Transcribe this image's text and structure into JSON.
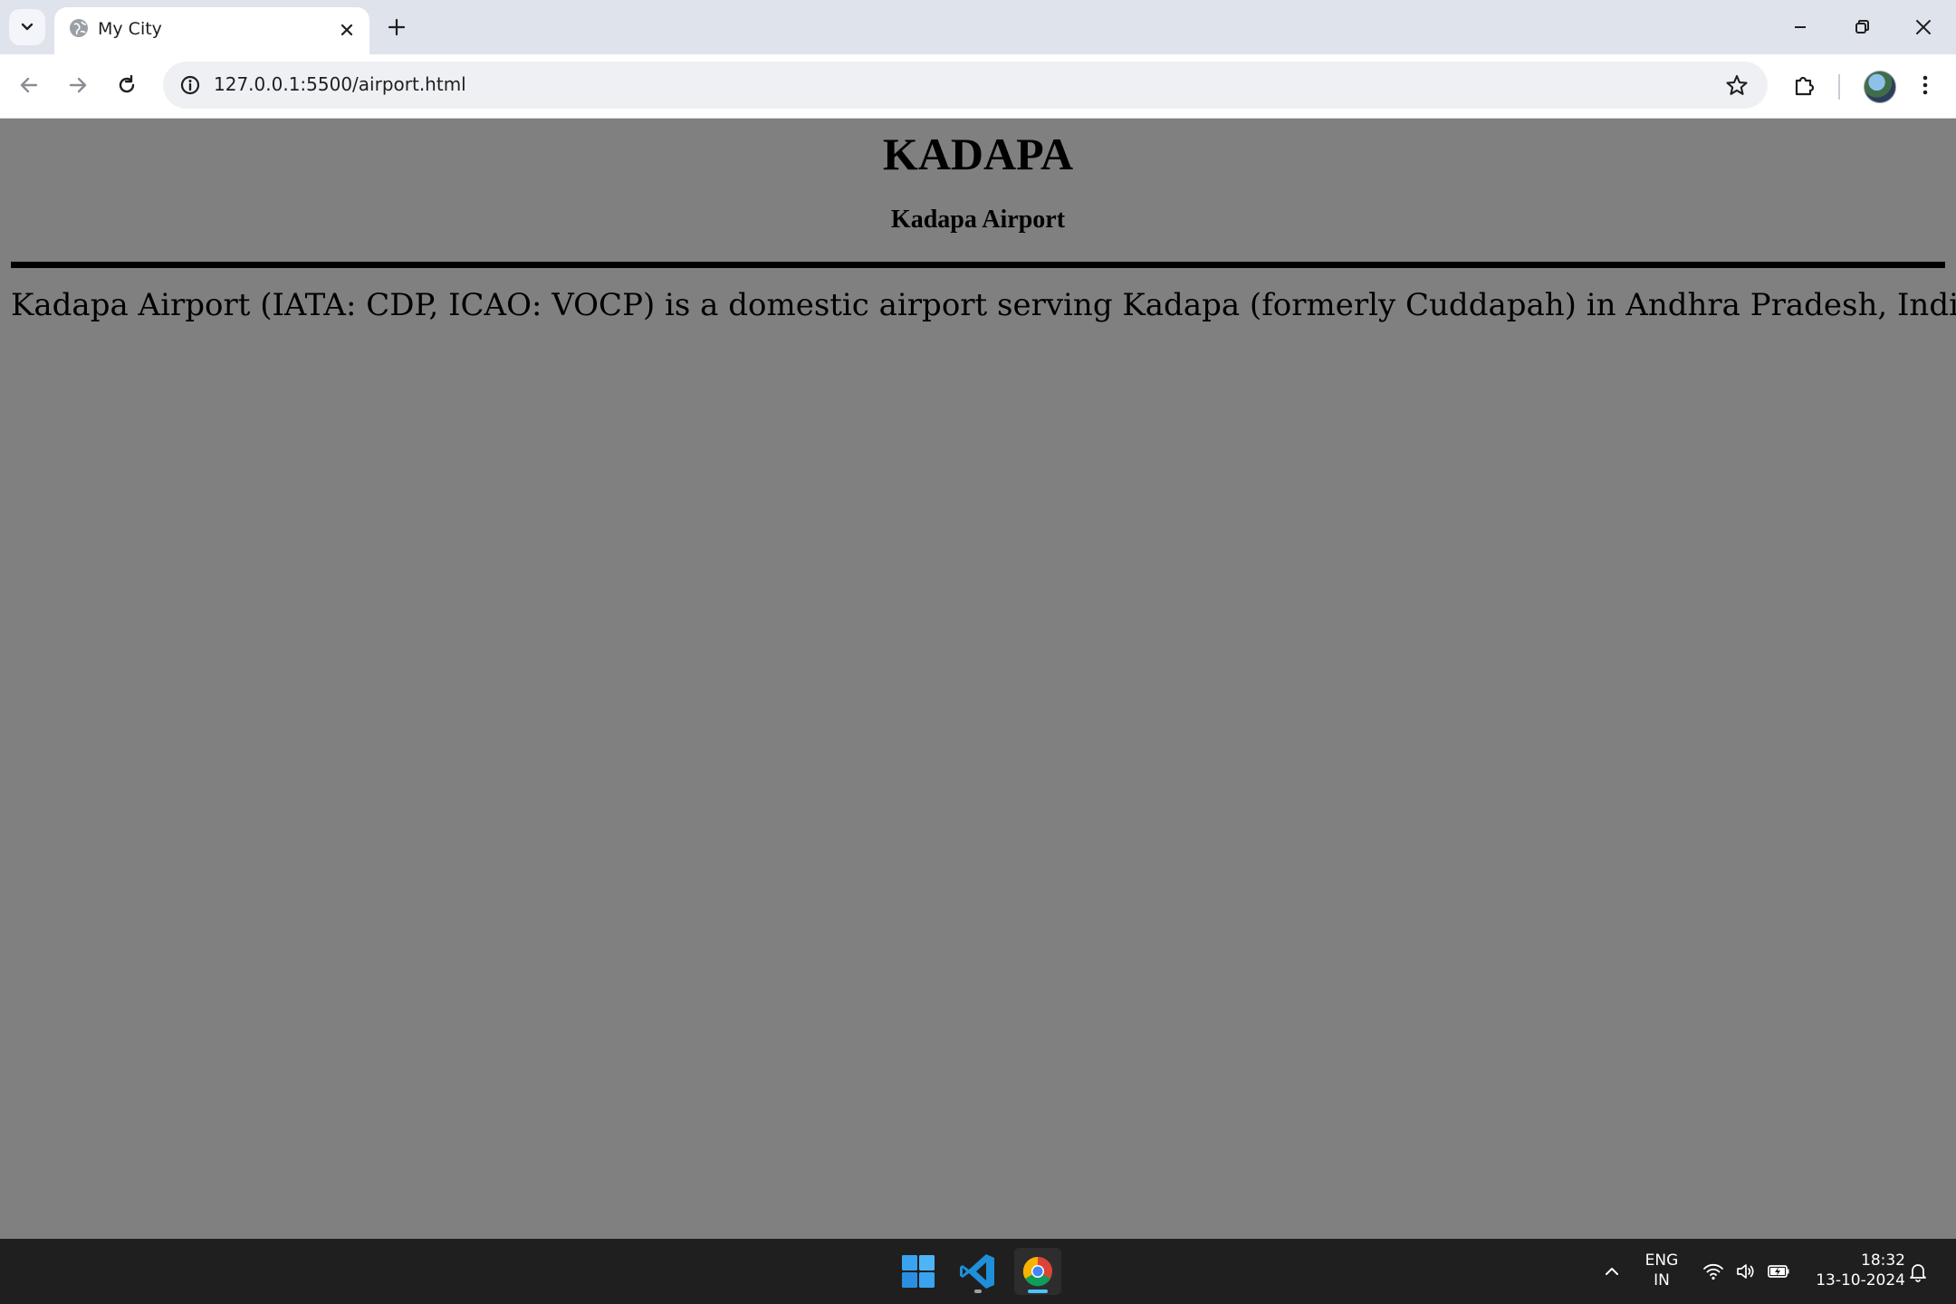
{
  "browser": {
    "tab": {
      "title": "My City",
      "favicon": "globe-icon"
    },
    "address_bar": {
      "url": "127.0.0.1:5500/airport.html"
    },
    "icons": {
      "tab_search": "chevron-down-icon",
      "tab_close": "close-icon",
      "new_tab": "plus-icon",
      "minimize": "minimize-icon",
      "restore": "restore-icon",
      "close_window": "close-icon",
      "back": "arrow-left-icon",
      "forward": "arrow-right-icon",
      "reload": "reload-icon",
      "site_info": "info-icon",
      "bookmark": "star-icon",
      "extensions": "puzzle-icon",
      "menu": "kebab-menu-icon"
    }
  },
  "page": {
    "background_color": "#808080",
    "heading": "KADAPA",
    "subheading": "Kadapa Airport",
    "paragraph": "Kadapa Airport (IATA: CDP, ICAO: VOCP) is a domestic airport serving Kadapa (formerly Cuddapah) in Andhra Pradesh, India."
  },
  "taskbar": {
    "apps": [
      "windows-start-icon",
      "vscode-icon",
      "chrome-icon"
    ],
    "language": {
      "line1": "ENG",
      "line2": "IN"
    },
    "clock": {
      "time": "18:32",
      "date": "13-10-2024"
    }
  }
}
